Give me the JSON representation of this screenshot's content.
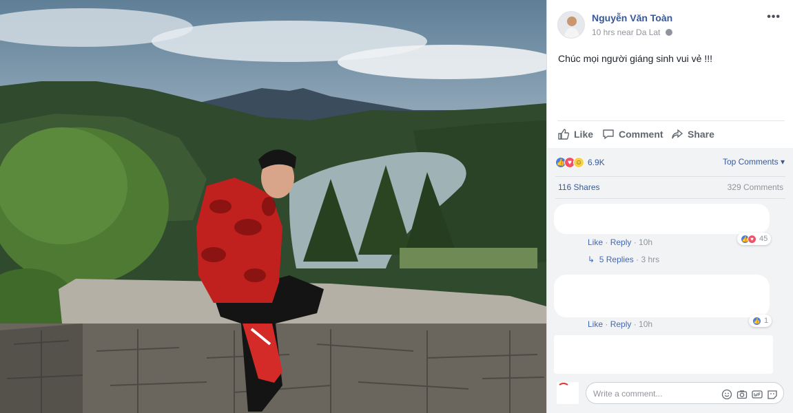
{
  "post": {
    "author": "Nguyễn Văn Toàn",
    "time_location": "10 hrs near Da Lat",
    "more": "•••",
    "text": "Chúc mọi người giáng sinh vui vẻ !!!"
  },
  "actions": {
    "like": "Like",
    "comment": "Comment",
    "share": "Share"
  },
  "stats": {
    "reaction_count": "6.9K",
    "top_comments": "Top Comments ▾",
    "shares": "116 Shares",
    "comments": "329 Comments"
  },
  "comments": [
    {
      "like": "Like",
      "reply": "Reply",
      "time": "10h",
      "reaction_count": "45"
    },
    {
      "like": "Like",
      "reply": "Reply",
      "time": "10h",
      "reaction_count": "1"
    }
  ],
  "replies": {
    "label": "5 Replies",
    "time": "3 hrs"
  },
  "composer": {
    "placeholder": "Write a comment..."
  },
  "colors": {
    "link": "#365899",
    "accent": "#4267b2",
    "muted": "#90949c",
    "panel": "#f2f3f5"
  }
}
